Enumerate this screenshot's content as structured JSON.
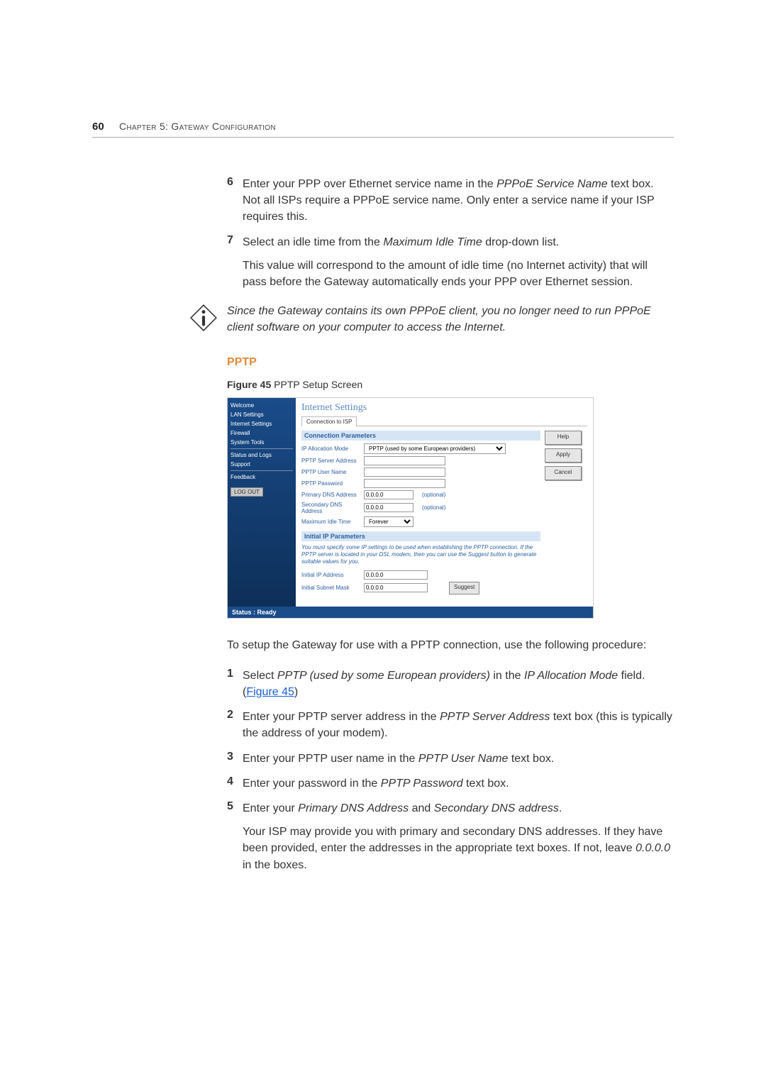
{
  "pageNumber": "60",
  "chapterTitle": "Chapter 5: Gateway Configuration",
  "step6_num": "6",
  "step6_a": "Enter your PPP over Ethernet service name in the ",
  "step6_b": "PPPoE Service Name",
  "step6_c": " text box. Not all ISPs require a PPPoE service name. Only enter a service name if your ISP requires this.",
  "step7_num": "7",
  "step7_a": "Select an idle time from the ",
  "step7_b": "Maximum Idle Time",
  "step7_c": " drop-down list.",
  "step7_p": "This value will correspond to the amount of idle time (no Internet activity) that will pass before the Gateway automatically ends your PPP over Ethernet session.",
  "note_text": "Since the Gateway contains its own PPPoE client, you no longer need to run PPPoE client software on your computer to access the Internet.",
  "section_heading": "PPTP",
  "figure_bold": "Figure 45",
  "figure_caption": "   PPTP Setup Screen",
  "screenshot": {
    "title": "Internet Settings",
    "tab": "Connection to ISP",
    "sidebar": {
      "welcome": "Welcome",
      "lan": "LAN Settings",
      "internet": "Internet Settings",
      "firewall": "Firewall",
      "system": "System Tools",
      "status": "Status and Logs",
      "support": "Support",
      "feedback": "Feedback",
      "logout": "LOG OUT"
    },
    "buttons": {
      "help": "Help",
      "apply": "Apply",
      "cancel": "Cancel",
      "suggest": "Suggest"
    },
    "panel1": "Connection Parameters",
    "labels": {
      "alloc": "IP Allocation Mode",
      "server": "PPTP Server Address",
      "user": "PPTP User Name",
      "pass": "PPTP Password",
      "pdns": "Primary DNS Address",
      "sdns": "Secondary DNS Address",
      "idle": "Maximum Idle Time"
    },
    "alloc_value": "PPTP (used by some European providers)",
    "zero": "0.0.0.0",
    "optional": "(optional)",
    "idle_value": "Forever",
    "panel2": "Initial IP Parameters",
    "ip_note": "You must specify some IP settings to be used when establishing the PPTP connection. If the PPTP server is located in your DSL modem, then you can use the Suggest button to generate suitable values for you.",
    "labels2": {
      "iip": "Initial IP Address",
      "ism": "Initial Subnet Mask"
    },
    "status": "Status : Ready"
  },
  "intro_a": "To setup the Gateway for use with a PPTP connection, use the following procedure:",
  "s1_num": "1",
  "s1_a": "Select ",
  "s1_b": "PPTP (used by some European providers)",
  "s1_c": " in the ",
  "s1_d": "IP Allocation Mode",
  "s1_e": " field. (",
  "s1_link": "Figure 45",
  "s1_f": ")",
  "s2_num": "2",
  "s2_a": "Enter your PPTP server address in the ",
  "s2_b": "PPTP Server Address",
  "s2_c": " text box (this is typically the address of your modem).",
  "s3_num": "3",
  "s3_a": "Enter your PPTP user name in the ",
  "s3_b": "PPTP User Name",
  "s3_c": " text box.",
  "s4_num": "4",
  "s4_a": "Enter your password in the ",
  "s4_b": "PPTP Password",
  "s4_c": " text box.",
  "s5_num": "5",
  "s5_a": "Enter your ",
  "s5_b": "Primary DNS Address",
  "s5_c": " and ",
  "s5_d": "Secondary DNS address",
  "s5_e": ".",
  "s5_p_a": "Your ISP may provide you with primary and secondary DNS addresses. If they have been provided, enter the addresses in the appropriate text boxes. If not, leave ",
  "s5_p_b": "0.0.0.0",
  "s5_p_c": " in the boxes."
}
